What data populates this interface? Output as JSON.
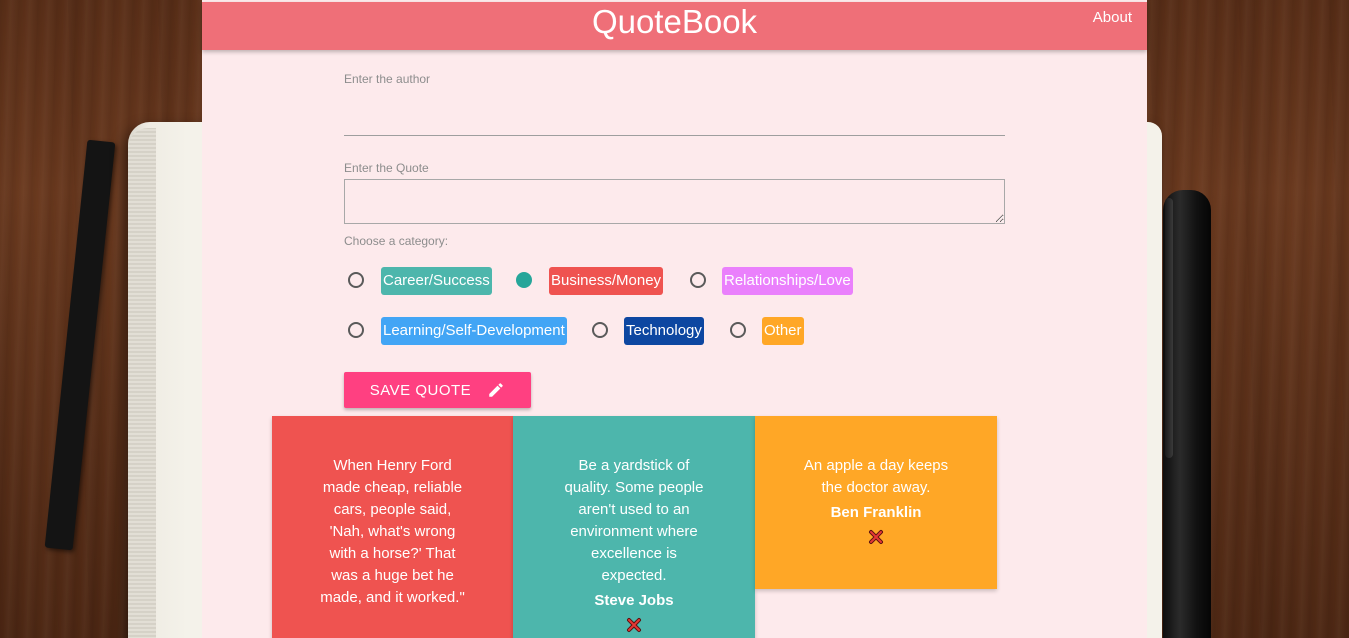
{
  "header": {
    "brand": "QuoteBook",
    "about": "About"
  },
  "form": {
    "author_label": "Enter the author",
    "author_value": "",
    "quote_label": "Enter the Quote",
    "quote_value": "",
    "category_label": "Choose a category:",
    "categories": [
      {
        "label": "Career/Success",
        "color": "#4db6ac",
        "selected": false
      },
      {
        "label": "Business/Money",
        "color": "#ef5350",
        "selected": true
      },
      {
        "label": "Relationships/Love",
        "color": "#ea80fc",
        "selected": false
      },
      {
        "label": "Learning/Self-Development",
        "color": "#42a5f5",
        "selected": false
      },
      {
        "label": "Technology",
        "color": "#0d47a1",
        "selected": false
      },
      {
        "label": "Other",
        "color": "#ffa726",
        "selected": false
      }
    ],
    "save_label": "SAVE QUOTE",
    "save_icon": "pencil-icon"
  },
  "quotes": [
    {
      "text": "When Henry Ford made cheap, reliable cars, people said, 'Nah, what's wrong with a horse?' That was a huge bet he made, and it worked.\"",
      "author": "",
      "color": "#ef5350"
    },
    {
      "text": "Be a yardstick of quality. Some people aren't used to an environment where excellence is expected.",
      "author": "Steve Jobs",
      "color": "#4db6ac"
    },
    {
      "text": "An apple a day keeps the doctor away.",
      "author": "Ben Franklin",
      "color": "#ffa726"
    }
  ],
  "colors": {
    "header": "#ef6f78",
    "page": "#fdeaec",
    "accent": "#ff4081",
    "radio_checked": "#26a69a"
  }
}
